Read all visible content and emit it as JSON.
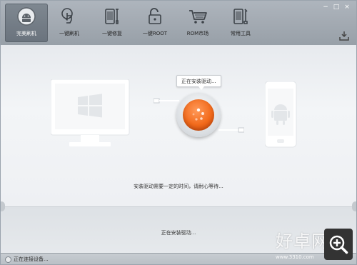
{
  "window": {
    "minimize": "−",
    "maximize": "□",
    "close": "×"
  },
  "nav": {
    "items": [
      {
        "label": "完美刷机",
        "icon": "android-icon",
        "active": true
      },
      {
        "label": "一键刷机",
        "icon": "touch-hand-icon"
      },
      {
        "label": "一键修复",
        "icon": "phone-wrench-icon"
      },
      {
        "label": "一键ROOT",
        "icon": "unlock-icon"
      },
      {
        "label": "ROM市场",
        "icon": "cart-icon"
      },
      {
        "label": "常用工具",
        "icon": "phone-tools-icon"
      }
    ]
  },
  "main": {
    "bubble_text": "正在安装驱动...",
    "hint_text": "安装驱动需要一定的时间，请耐心等待...",
    "status_text": "正在安装驱动..."
  },
  "statusbar": {
    "connection_text": "正在连接设备..."
  },
  "watermark": {
    "text": "好卓网",
    "url": "www.3310.com"
  },
  "colors": {
    "accent_orange": "#f26a1b",
    "header_gray": "#a2a9b1",
    "active_tab": "#707982"
  }
}
